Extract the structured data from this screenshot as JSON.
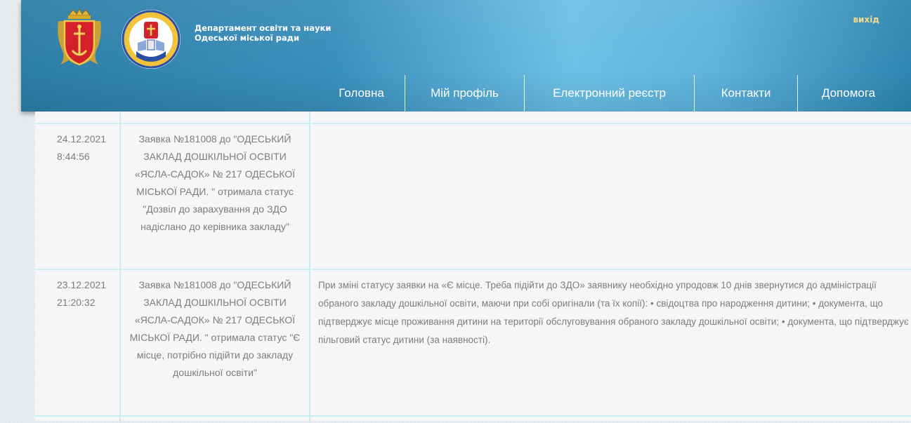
{
  "header": {
    "org_name": "Департамент освіти та науки Одеської міської ради",
    "logout_label": "вихід"
  },
  "nav": {
    "items": [
      {
        "label": "Головна"
      },
      {
        "label": "Мій профіль"
      },
      {
        "label": "Електронний реєстр"
      },
      {
        "label": "Контакти"
      },
      {
        "label": "Допомога"
      }
    ]
  },
  "notifications": [
    {
      "date": "24.12.2021",
      "time": "8:44:56",
      "application": "Заявка №181008 до \"ОДЕСЬКИЙ ЗАКЛАД ДОШКІЛЬНОЇ ОСВІТИ «ЯСЛА-САДОК» № 217 ОДЕСЬКОЇ МІСЬКОЇ РАДИ. \" отримала статус \"Дозвіл до зарахування до ЗДО надіслано до керівника закладу\"",
      "note": ""
    },
    {
      "date": "23.12.2021",
      "time": "21:20:32",
      "application": "Заявка №181008 до \"ОДЕСЬКИЙ ЗАКЛАД ДОШКІЛЬНОЇ ОСВІТИ «ЯСЛА-САДОК» № 217 ОДЕСЬКОЇ МІСЬКОЇ РАДИ. \" отримала статус \"Є місце, потрібно підійти до закладу дошкільної освіти\"",
      "note": "При зміні статусу заявки на «Є місце. Треба підійти до ЗДО» заявнику необхідно упродовж 10 днів звернутися до адміністрації обраного закладу дошкільної освіти, маючи при собі оригінали (та їх копії): • свідоцтва про народження дитини; • документа, що підтверджує місце проживання дитини на території обслуговування обраного закладу дошкільної освіти; • документа, що підтверджує пільговий статус дитини (за наявності)."
    }
  ],
  "colors": {
    "header_blue": "#3a8fbb",
    "logout_gold": "#f3dc8a",
    "grid_line": "#cdebf2",
    "text_gray": "#7d7d7d"
  }
}
